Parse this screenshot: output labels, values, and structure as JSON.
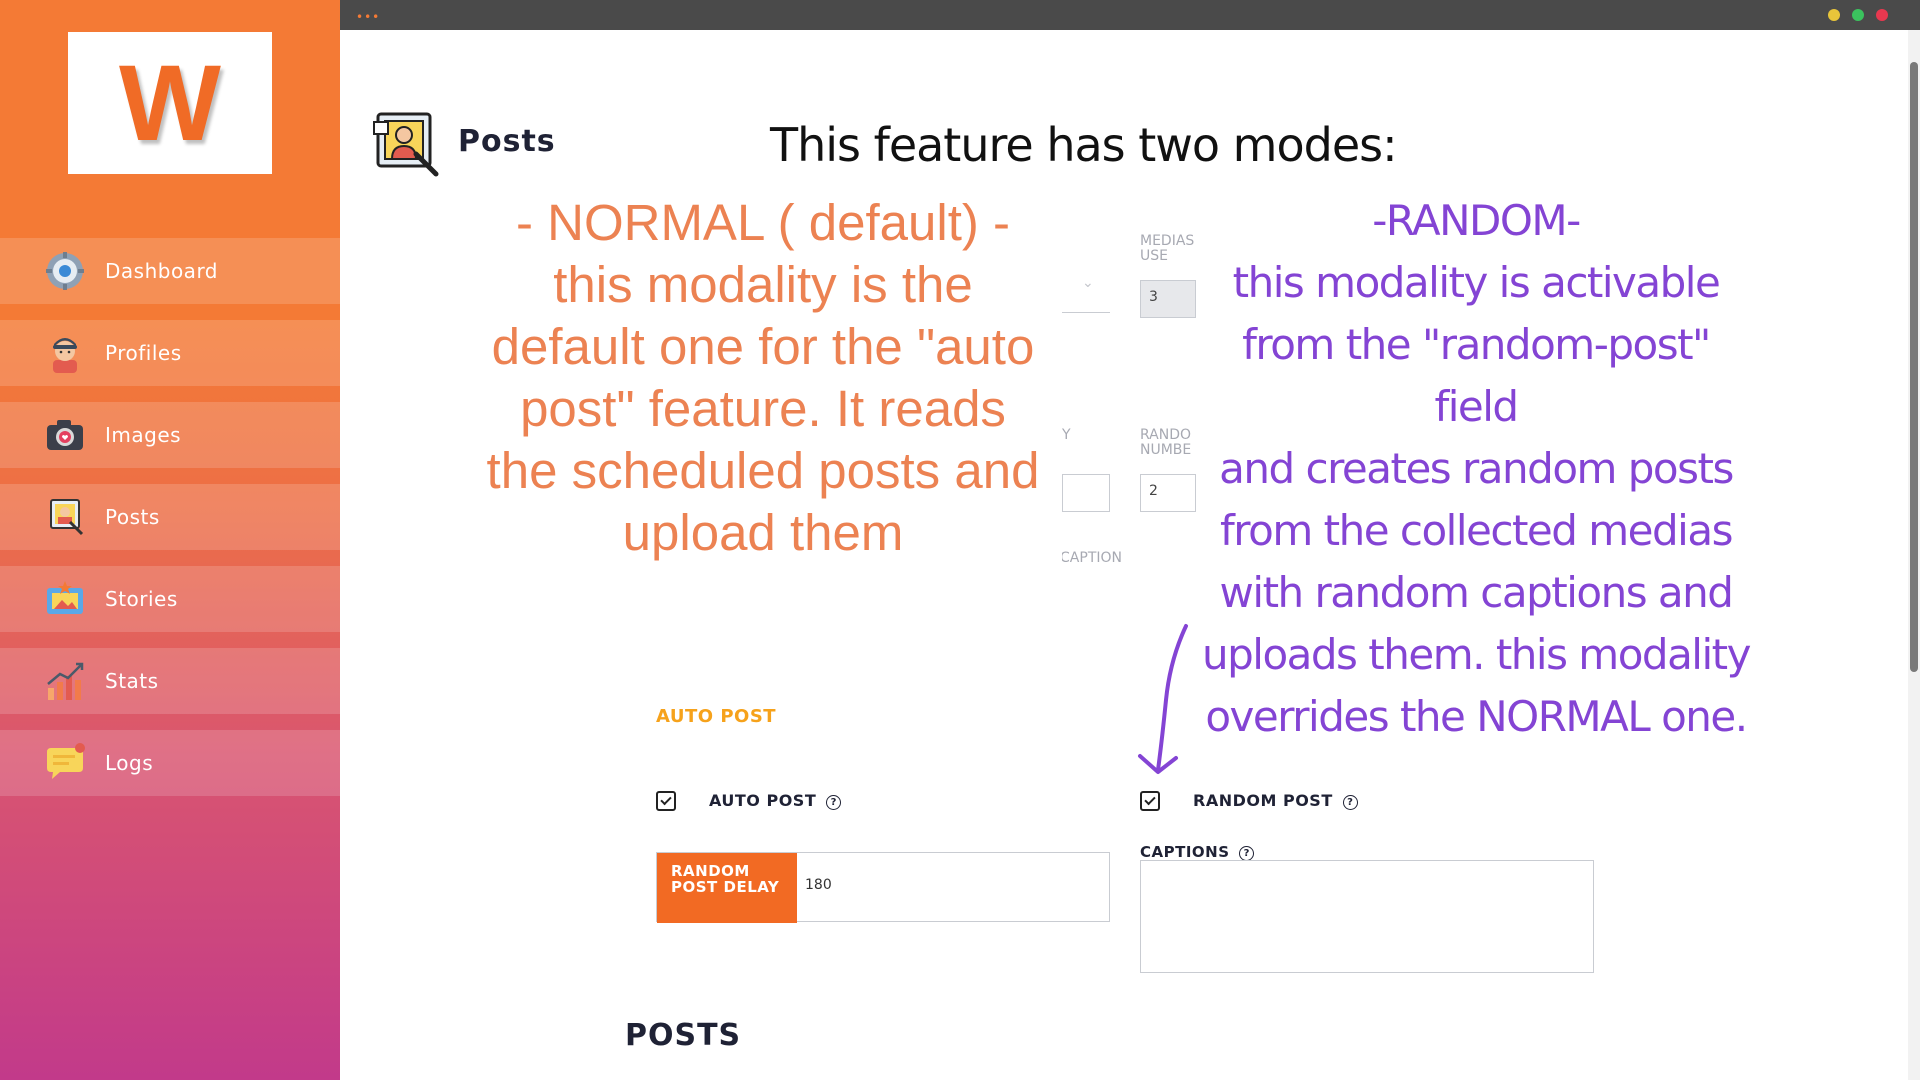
{
  "logo": {
    "letter": "W"
  },
  "sidebar": {
    "items": [
      {
        "label": "Dashboard",
        "icon": "dashboard-icon"
      },
      {
        "label": "Profiles",
        "icon": "profile-icon"
      },
      {
        "label": "Images",
        "icon": "camera-icon"
      },
      {
        "label": "Posts",
        "icon": "posts-icon"
      },
      {
        "label": "Stories",
        "icon": "stories-icon"
      },
      {
        "label": "Stats",
        "icon": "stats-icon"
      },
      {
        "label": "Logs",
        "icon": "logs-icon"
      }
    ]
  },
  "topbar": {
    "menu_dots": "•••",
    "window_dots": [
      "#e8c53a",
      "#3bc35e",
      "#e8384f"
    ]
  },
  "page": {
    "title": "Posts"
  },
  "fragments": {
    "medias_use_label": "MEDIAS\nUSE",
    "medias_use_value": "3",
    "y_label": "Y",
    "random_number_label": "RANDO\nNUMBE",
    "random_number_value": "2",
    "caption_label": "CAPTION"
  },
  "annotations": {
    "title": "This feature has two modes:",
    "normal": "- NORMAL ( default) - this modality is the default one for the \"auto post\" feature. It reads the scheduled posts and upload them",
    "random_lines": [
      "-RANDOM-",
      "this modality is activable",
      "from the \"random-post\"",
      "field",
      "and creates random posts",
      "from the collected medias",
      "with random captions and",
      "uploads them. this modality",
      "overrides the NORMAL one."
    ]
  },
  "auto_post": {
    "section_title": "AUTO POST",
    "auto_post_label": "AUTO POST",
    "auto_post_checked": true,
    "random_post_label": "RANDOM POST",
    "random_post_checked": true,
    "delay_label": "RANDOM POST DELAY",
    "delay_value": "180",
    "captions_label": "CAPTIONS",
    "captions_value": "",
    "help_glyph": "?"
  },
  "posts_section": {
    "title": "POSTS"
  },
  "colors": {
    "brand_orange": "#f26a23",
    "section_title": "#f6a21b",
    "annotation_normal": "#ec8252",
    "annotation_random": "#8444d4"
  }
}
